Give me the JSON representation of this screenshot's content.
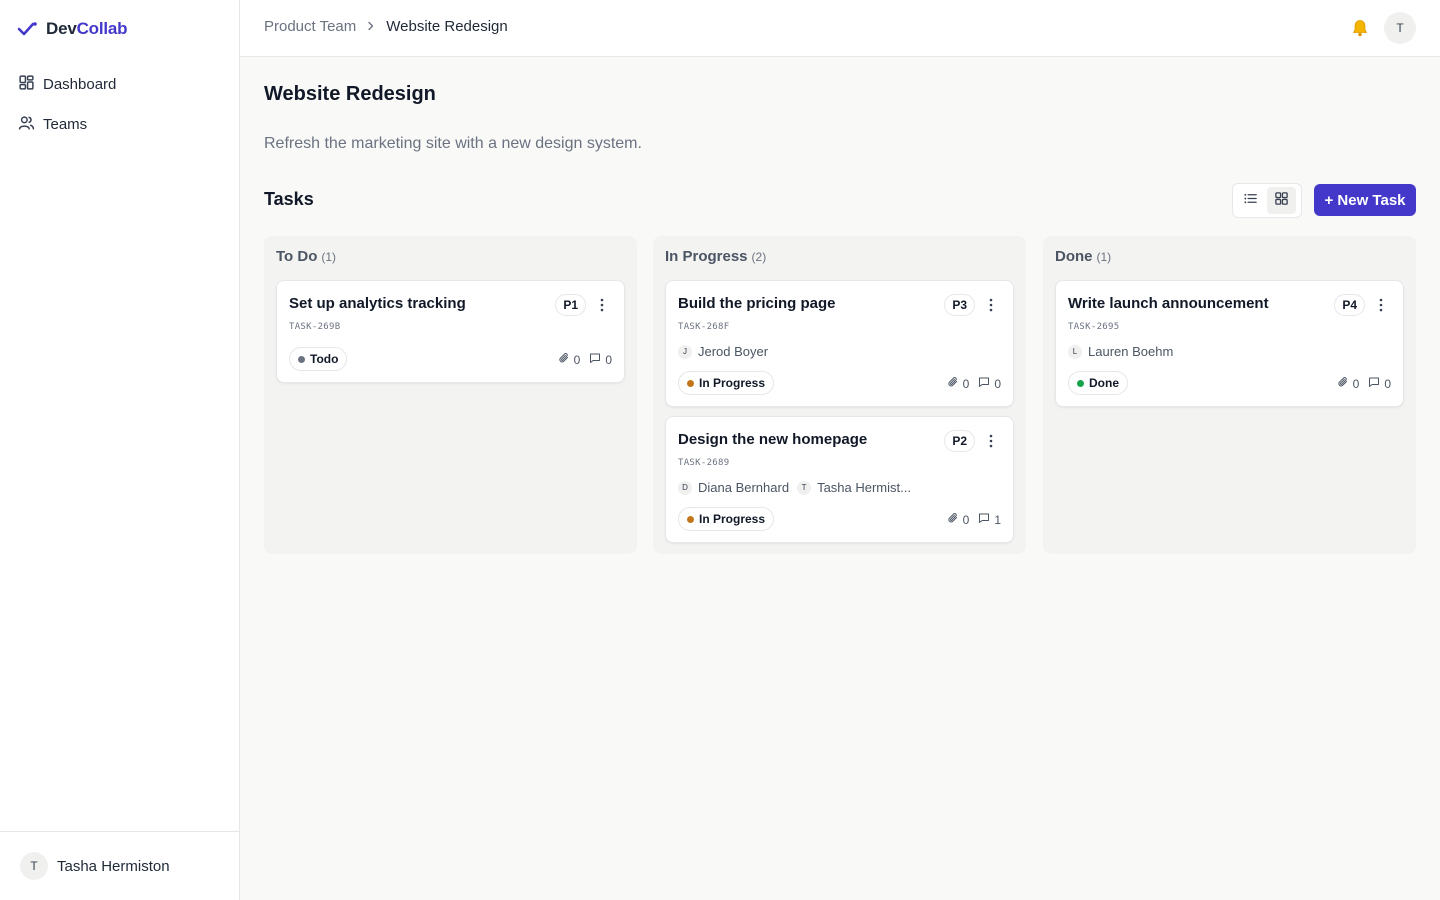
{
  "app": {
    "name_a": "Dev",
    "name_b": "Collab"
  },
  "sidebar": {
    "items": [
      {
        "label": "Dashboard",
        "icon": "grid-icon"
      },
      {
        "label": "Teams",
        "icon": "users-icon"
      }
    ],
    "user": {
      "initial": "T",
      "name": "Tasha Hermiston"
    }
  },
  "header": {
    "breadcrumb": [
      "Product Team",
      "Website Redesign"
    ],
    "avatar_initial": "T"
  },
  "project": {
    "title": "Website Redesign",
    "description": "Refresh the marketing site with a new design system."
  },
  "tasks_section": {
    "title": "Tasks",
    "new_task_label": "+ New Task"
  },
  "columns": [
    {
      "name": "To Do",
      "count": "(1)",
      "cards": [
        {
          "title": "Set up analytics tracking",
          "priority": "P1",
          "id": "TASK-269B",
          "assignees": [],
          "status": "Todo",
          "status_color": "#6b7280",
          "attachments": "0",
          "comments": "0"
        }
      ]
    },
    {
      "name": "In Progress",
      "count": "(2)",
      "cards": [
        {
          "title": "Build the pricing page",
          "priority": "P3",
          "id": "TASK-268F",
          "assignees": [
            {
              "initial": "J",
              "name": "Jerod Boyer"
            }
          ],
          "status": "In Progress",
          "status_color": "#c2761a",
          "attachments": "0",
          "comments": "0"
        },
        {
          "title": "Design the new homepage",
          "priority": "P2",
          "id": "TASK-2689",
          "assignees": [
            {
              "initial": "D",
              "name": "Diana Bernhard"
            },
            {
              "initial": "T",
              "name": "Tasha Hermist..."
            }
          ],
          "status": "In Progress",
          "status_color": "#c2761a",
          "attachments": "0",
          "comments": "1"
        }
      ]
    },
    {
      "name": "Done",
      "count": "(1)",
      "cards": [
        {
          "title": "Write launch announcement",
          "priority": "P4",
          "id": "TASK-2695",
          "assignees": [
            {
              "initial": "L",
              "name": "Lauren Boehm"
            }
          ],
          "status": "Done",
          "status_color": "#16a34a",
          "attachments": "0",
          "comments": "0"
        }
      ]
    }
  ],
  "colors": {
    "accent": "#4338ca",
    "in_progress": "#c2761a",
    "done": "#16a34a",
    "todo": "#6b7280"
  }
}
